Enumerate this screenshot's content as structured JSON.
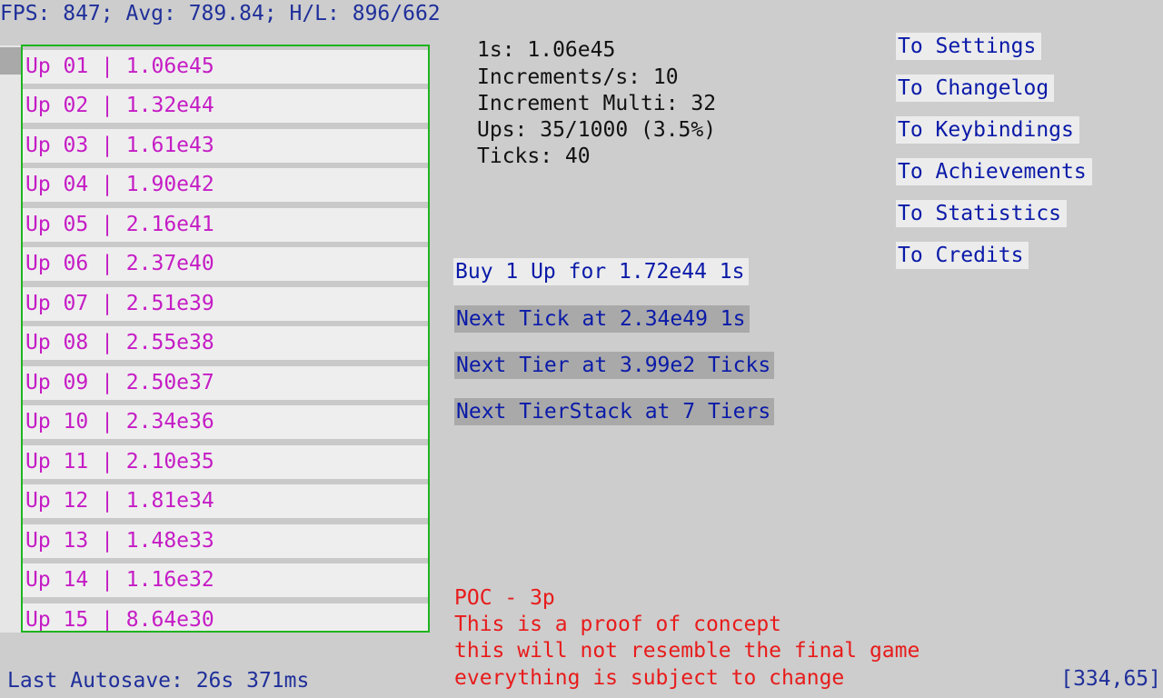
{
  "header": {
    "fps_text": "FPS: 847; Avg: 789.84; H/L: 896/662"
  },
  "ups": [
    "Up 01 | 1.06e45",
    "Up 02 | 1.32e44",
    "Up 03 | 1.61e43",
    "Up 04 | 1.90e42",
    "Up 05 | 2.16e41",
    "Up 06 | 2.37e40",
    "Up 07 | 2.51e39",
    "Up 08 | 2.55e38",
    "Up 09 | 2.50e37",
    "Up 10 | 2.34e36",
    "Up 11 | 2.10e35",
    "Up 12 | 1.81e34",
    "Up 13 | 1.48e33",
    "Up 14 | 1.16e32",
    "Up 15 | 8.64e30"
  ],
  "stats": {
    "ones": "1s: 1.06e45",
    "increments": "Increments/s: 10",
    "multi": "Increment Multi: 32",
    "ups": "Ups: 35/1000 (3.5%)",
    "ticks": "Ticks: 40"
  },
  "actions": {
    "buy": "Buy 1 Up for 1.72e44 1s",
    "next_tick": "Next Tick at 2.34e49 1s",
    "next_tier": "Next Tier at 3.99e2 Ticks",
    "next_tierstack": "Next TierStack at 7 Tiers"
  },
  "nav": {
    "settings": "To Settings",
    "changelog": "To Changelog",
    "keybindings": "To Keybindings",
    "achievements": "To Achievements",
    "statistics": "To Statistics",
    "credits": "To Credits"
  },
  "footer": {
    "autosave": "Last Autosave: 26s 371ms",
    "poc_title": "POC - 3p",
    "poc_line1": "This is a proof of concept",
    "poc_line2": "this will not resemble the final game",
    "poc_line3": "everything is subject to change",
    "coords": "[334,65]"
  },
  "colors": {
    "background": "#cdcdcd",
    "list_border": "#1fb41f",
    "up_text": "#c51cc5",
    "button_text": "#0a1aa8",
    "info_text": "#1f2f9a",
    "warning_text": "#e81b1b"
  }
}
